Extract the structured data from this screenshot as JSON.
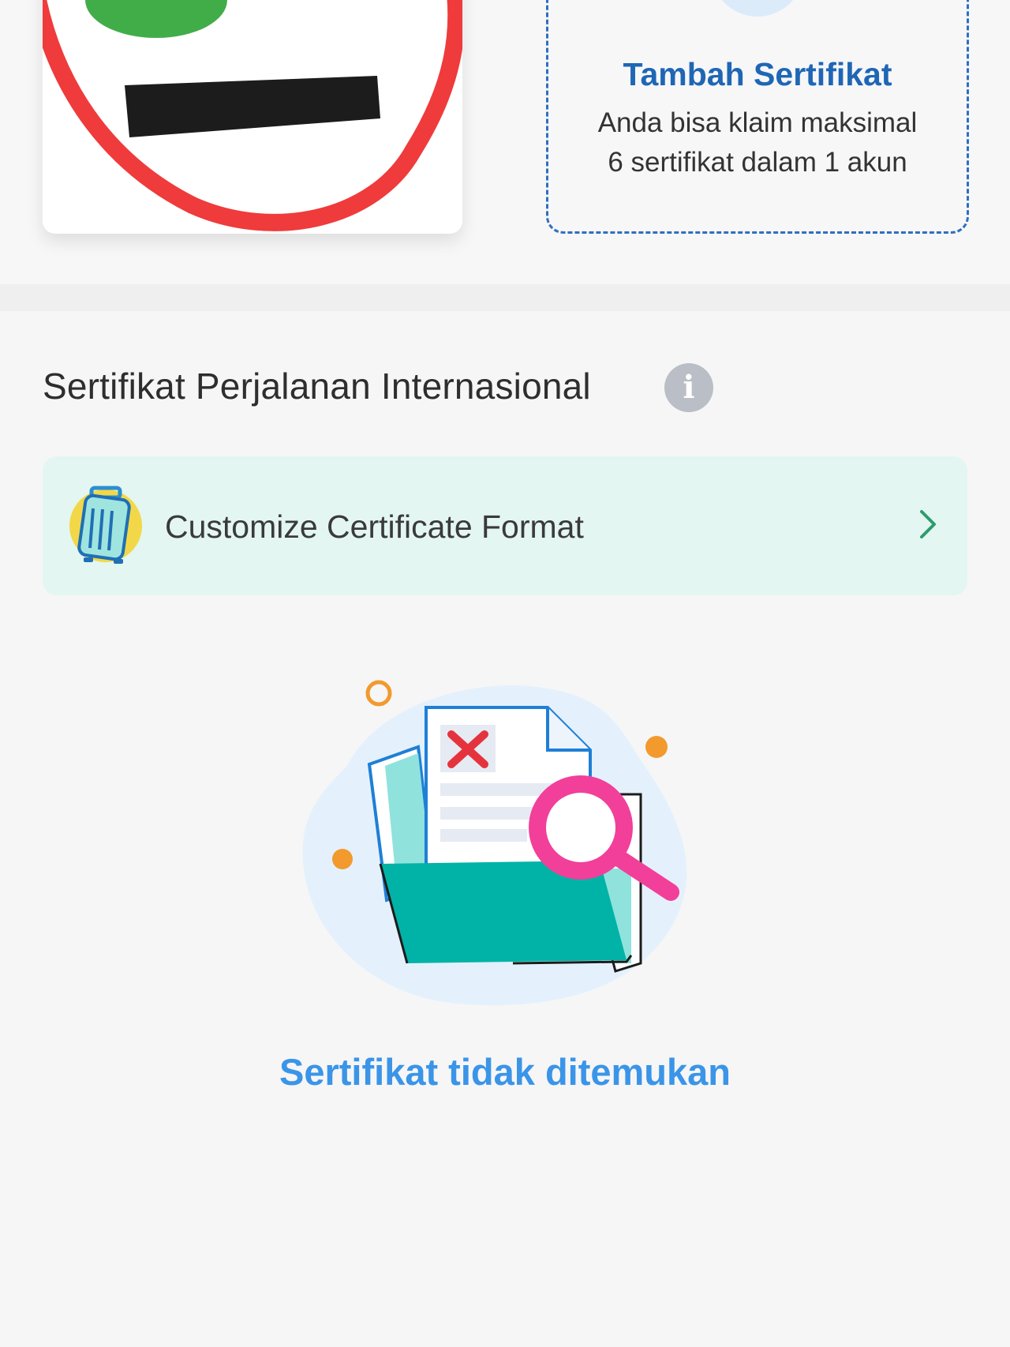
{
  "add_certificate": {
    "title": "Tambah Sertifikat",
    "description": "Anda bisa klaim maksimal 6 sertifikat dalam 1 akun"
  },
  "section": {
    "title": "Sertifikat Perjalanan Internasional",
    "info_icon": "i"
  },
  "customize": {
    "label": "Customize Certificate Format",
    "icon": "luggage-icon"
  },
  "empty_state": {
    "message": "Sertifikat tidak ditemukan",
    "icon": "folder-search-illustration"
  },
  "colors": {
    "accent_blue": "#1f66b5",
    "empty_text_blue": "#3a95e8",
    "customize_bg": "#e3f6f1",
    "chevron_green": "#2e9b6f",
    "annotation_red": "#ef3b3b"
  }
}
